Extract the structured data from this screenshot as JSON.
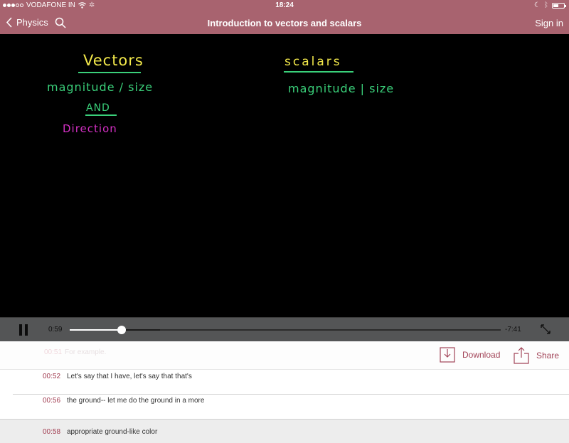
{
  "status_bar": {
    "carrier": "VODAFONE IN",
    "signal_filled": 3,
    "signal_total": 5,
    "time": "18:24",
    "battery_level": 0.5
  },
  "nav": {
    "back_label": "Physics",
    "title": "Introduction to vectors and scalars",
    "signin_label": "Sign in"
  },
  "video": {
    "board": {
      "left_heading": "Vectors",
      "left_line1": "magnitude / size",
      "left_and": "AND",
      "left_line2": "Direction",
      "right_heading": "scalars",
      "right_line1": "magnitude | size"
    },
    "colors": {
      "heading": "#f2e84a",
      "body": "#3ad07a",
      "accent": "#d430c4"
    }
  },
  "player": {
    "current_time": "0:59",
    "remaining_time": "-7:41",
    "progress_fraction": 0.12,
    "buffered_fraction": 0.21
  },
  "actions": {
    "download_label": "Download",
    "share_label": "Share"
  },
  "transcript": {
    "faded": {
      "time": "00:51",
      "text": "For example."
    },
    "items": [
      {
        "time": "00:52",
        "text": "Let's say that I have, let's say that that's"
      },
      {
        "time": "00:56",
        "text": "the ground-- let me do the ground in a more"
      },
      {
        "time": "00:58",
        "text": "appropriate ground-like color"
      }
    ]
  },
  "theme": {
    "brand": "#a8636f",
    "accent_text": "#a24458"
  }
}
